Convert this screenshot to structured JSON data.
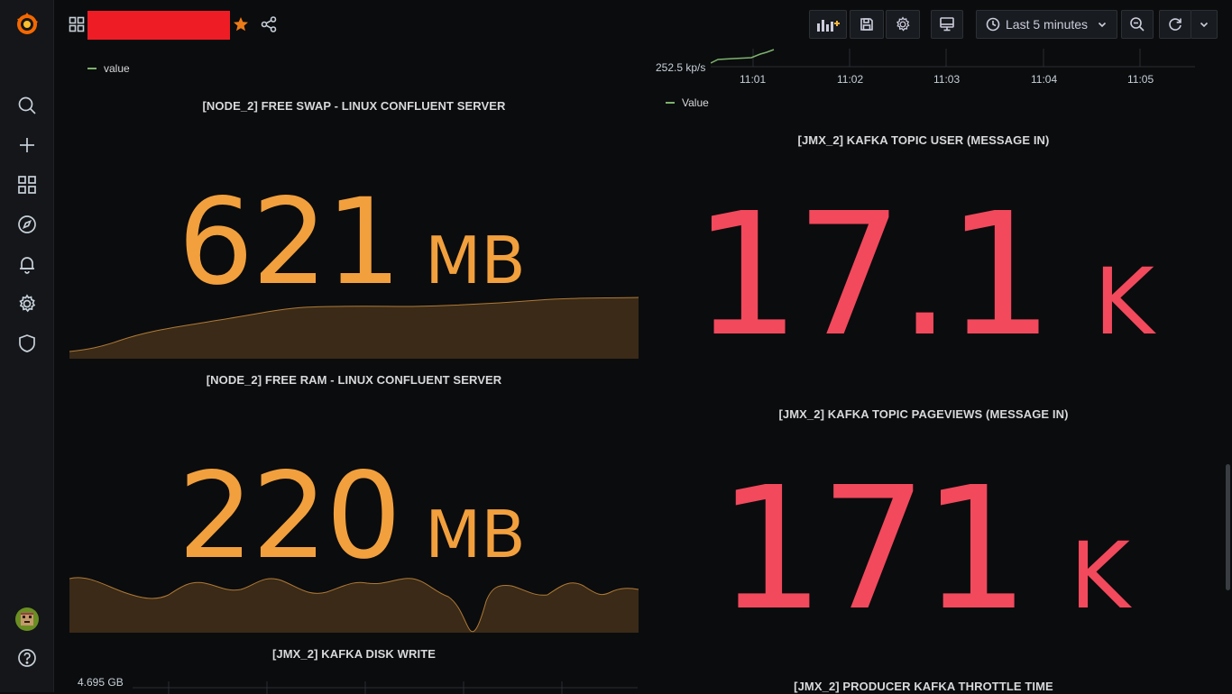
{
  "topbar": {
    "dashboard_title": "",
    "time_range": "Last 5 minutes"
  },
  "colors": {
    "orange": "#f2a03d",
    "red": "#f2495c",
    "green": "#7eb26d",
    "redaction": "#ee1c25"
  },
  "sidebar": {
    "icons": [
      "grafana-logo-icon",
      "search-icon",
      "plus-icon",
      "dashboards-icon",
      "explore-icon",
      "alerting-icon",
      "settings-icon",
      "shield-icon",
      "avatar",
      "help-icon"
    ]
  },
  "panels": {
    "top_left_legend": "value",
    "free_swap": {
      "title": "[NODE_2] FREE SWAP - LINUX CONFLUENT SERVER",
      "value": "621",
      "unit": "MB"
    },
    "free_ram": {
      "title": "[NODE_2] FREE RAM - LINUX CONFLUENT SERVER",
      "value": "220",
      "unit": "MB"
    },
    "disk_write": {
      "title": "[JMX_2] KAFKA DISK WRITE",
      "y_tick": "4.695 GB"
    },
    "top_right_graph": {
      "y_tick": "252.5 kp/s",
      "x_ticks": [
        "11:01",
        "11:02",
        "11:03",
        "11:04",
        "11:05"
      ],
      "legend": "Value"
    },
    "topic_user": {
      "title": "[JMX_2] KAFKA TOPIC USER (MESSAGE IN)",
      "value": "17.1",
      "unit": "K"
    },
    "topic_pageviews": {
      "title": "[JMX_2] KAFKA TOPIC PAGEVIEWS (MESSAGE IN)",
      "value": "171",
      "unit": "K"
    },
    "throttle_time": {
      "title": "[JMX_2] PRODUCER KAFKA THROTTLE TIME"
    }
  }
}
